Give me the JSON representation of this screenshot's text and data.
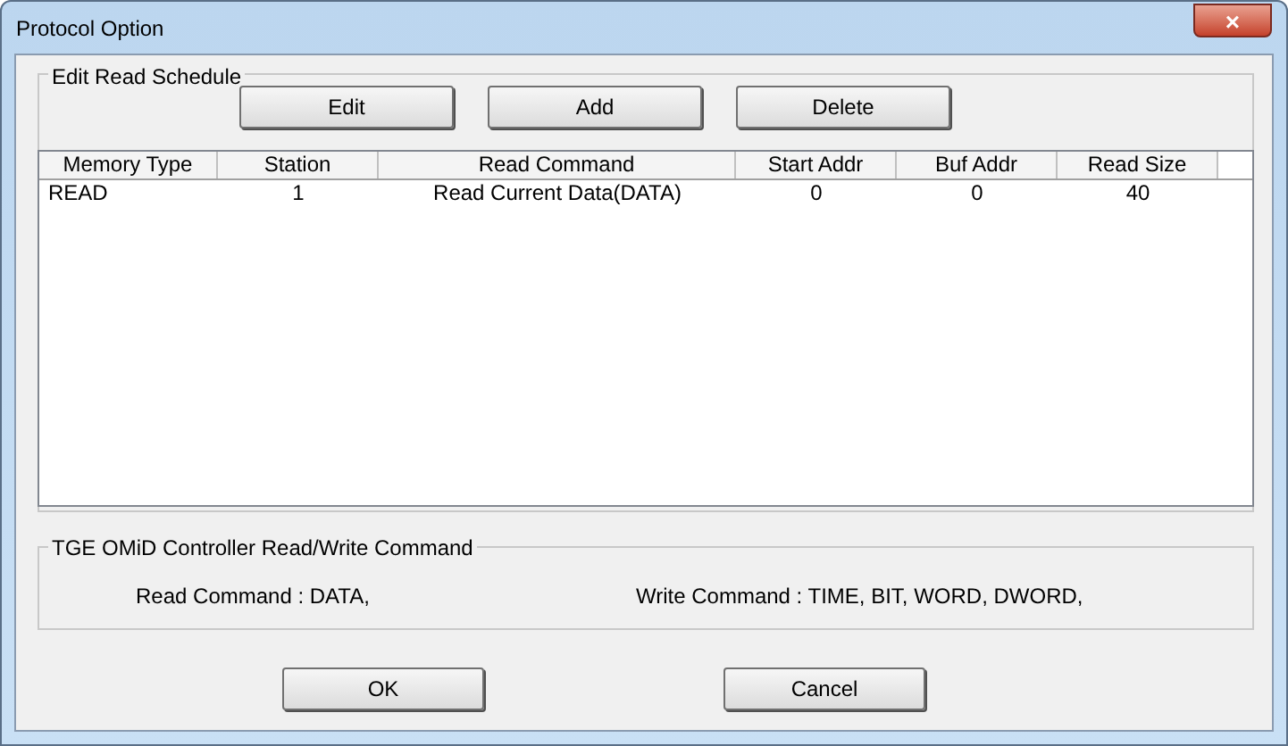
{
  "window": {
    "title": "Protocol Option",
    "close": "×"
  },
  "schedule": {
    "title": "Edit Read Schedule",
    "buttons": [
      "Edit",
      "Add",
      "Delete"
    ],
    "columns": [
      "Memory Type",
      "Station",
      "Read Command",
      "Start Addr",
      "Buf Addr",
      "Read Size"
    ],
    "rows": [
      [
        "READ",
        "1",
        "Read Current Data(DATA)",
        "0",
        "0",
        "40"
      ]
    ]
  },
  "commands": {
    "title": "TGE OMiD Controller Read/Write Command",
    "read": "Read Command : DATA,",
    "write": "Write Command : TIME, BIT, WORD, DWORD,"
  },
  "buttons": [
    "OK",
    "Cancel"
  ]
}
